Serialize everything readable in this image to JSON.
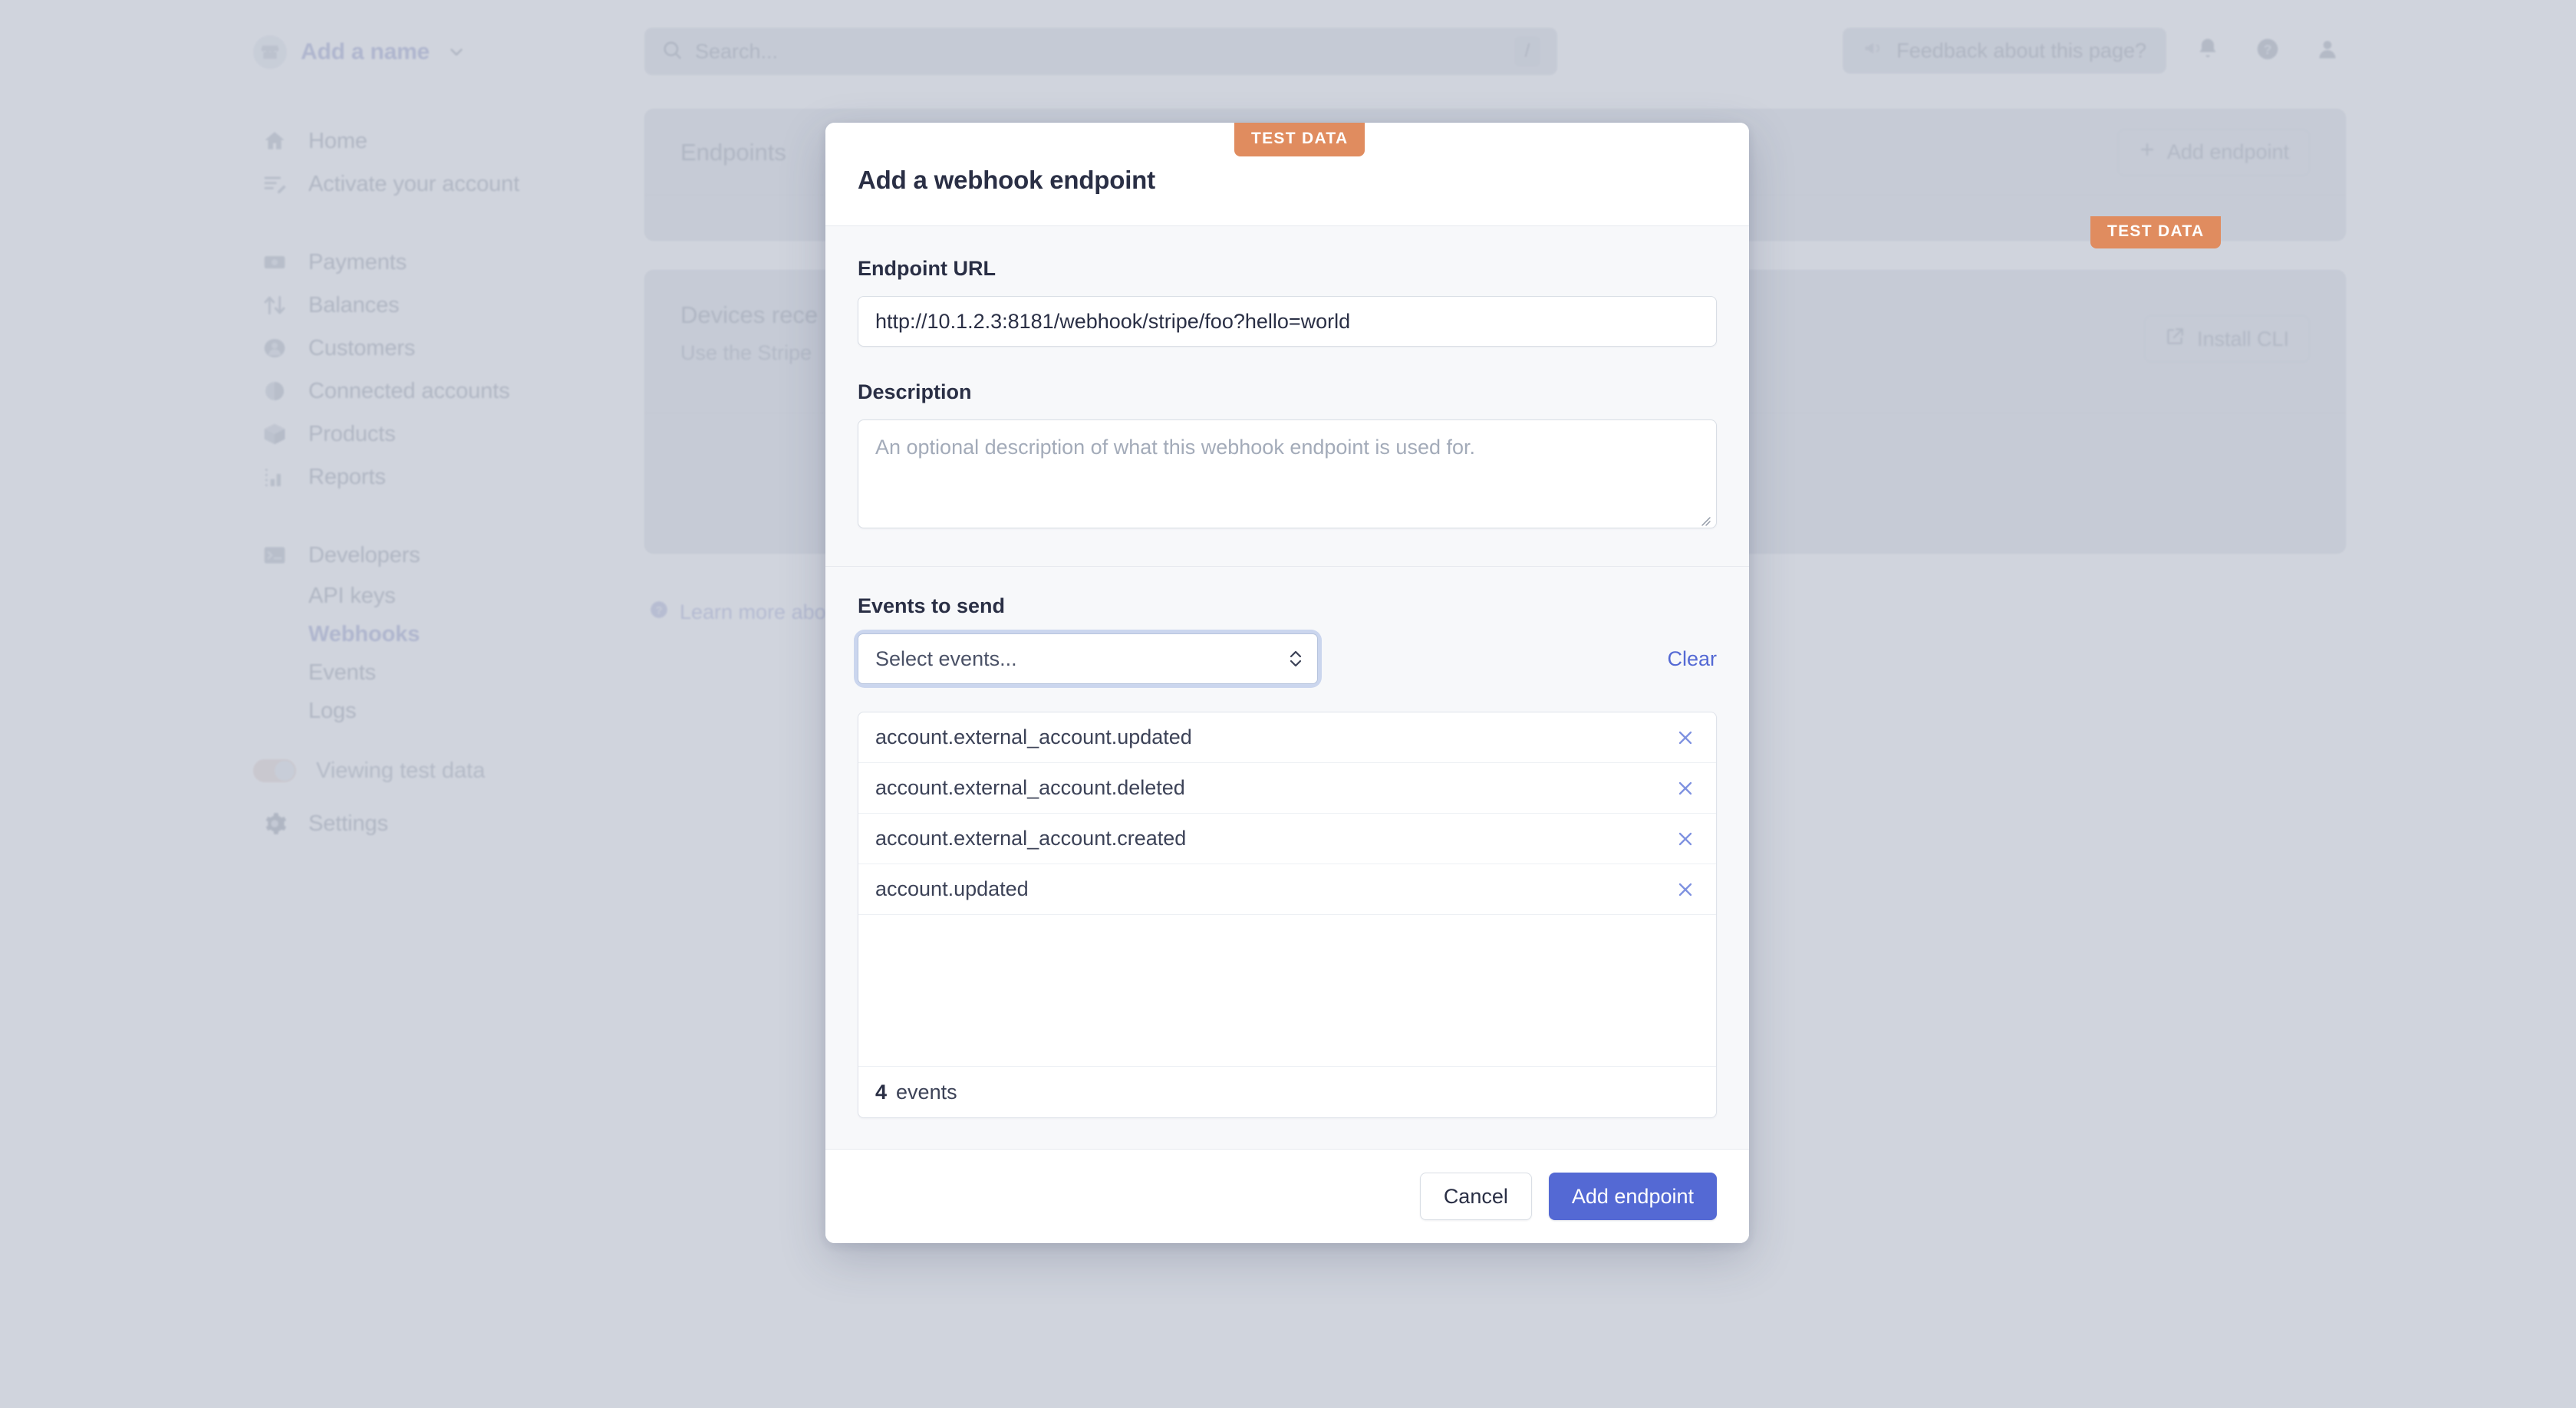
{
  "topbar": {
    "brand_name": "Add a name",
    "brand_icon": "storefront-icon",
    "brand_chevron_icon": "chevron-down-icon",
    "search_placeholder": "Search...",
    "search_icon": "search-icon",
    "search_shortcut": "/",
    "feedback_label": "Feedback about this page?",
    "feedback_icon": "megaphone-icon",
    "notifications_icon": "bell-icon",
    "help_icon": "question-circle-icon",
    "profile_icon": "user-avatar-icon"
  },
  "sidebar": {
    "primary_items": [
      {
        "label": "Home",
        "icon": "home-icon"
      },
      {
        "label": "Activate your account",
        "icon": "activate-account-icon"
      }
    ],
    "section_items": [
      {
        "label": "Payments",
        "icon": "payments-icon"
      },
      {
        "label": "Balances",
        "icon": "balances-icon"
      },
      {
        "label": "Customers",
        "icon": "customers-icon"
      },
      {
        "label": "Connected accounts",
        "icon": "connected-accounts-icon"
      },
      {
        "label": "Products",
        "icon": "products-icon"
      },
      {
        "label": "Reports",
        "icon": "reports-icon"
      }
    ],
    "developers": {
      "label": "Developers",
      "icon": "terminal-icon"
    },
    "developer_items": [
      {
        "label": "API keys",
        "active": false
      },
      {
        "label": "Webhooks",
        "active": true
      },
      {
        "label": "Events",
        "active": false
      },
      {
        "label": "Logs",
        "active": false
      }
    ],
    "test_data_toggle": {
      "label": "Viewing test data",
      "enabled": true,
      "color": "#e7d2cb"
    },
    "settings": {
      "label": "Settings",
      "icon": "gear-icon"
    }
  },
  "main": {
    "test_data_badge": "TEST DATA",
    "endpoints_card": {
      "title": "Endpoints",
      "add_button_label": "Add endpoint",
      "add_button_icon": "plus-icon"
    },
    "devices_card": {
      "title": "Devices rece",
      "subtitle": "Use the Stripe",
      "install_button_label": "Install CLI",
      "install_button_icon": "external-link-icon"
    },
    "learn_more": {
      "label": "Learn more abo",
      "icon": "question-circle-icon"
    }
  },
  "modal": {
    "test_data_badge": "TEST DATA",
    "badge_color": "#e08c5f",
    "title": "Add a webhook endpoint",
    "endpoint_url": {
      "label": "Endpoint URL",
      "value": "http://10.1.2.3:8181/webhook/stripe/foo?hello=world"
    },
    "description": {
      "label": "Description",
      "value": "",
      "placeholder": "An optional description of what this webhook endpoint is used for."
    },
    "events": {
      "label": "Events to send",
      "select_value": "Select events...",
      "select_icon": "chevron-up-down-icon",
      "clear_label": "Clear",
      "clear_color": "#5469d4",
      "selected": [
        {
          "name": "account.external_account.updated",
          "remove_icon": "close-icon"
        },
        {
          "name": "account.external_account.deleted",
          "remove_icon": "close-icon"
        },
        {
          "name": "account.external_account.created",
          "remove_icon": "close-icon"
        },
        {
          "name": "account.updated",
          "remove_icon": "close-icon"
        }
      ],
      "count": "4",
      "count_label": "events"
    },
    "footer": {
      "cancel_label": "Cancel",
      "submit_label": "Add endpoint",
      "submit_color": "#5469d4"
    }
  }
}
